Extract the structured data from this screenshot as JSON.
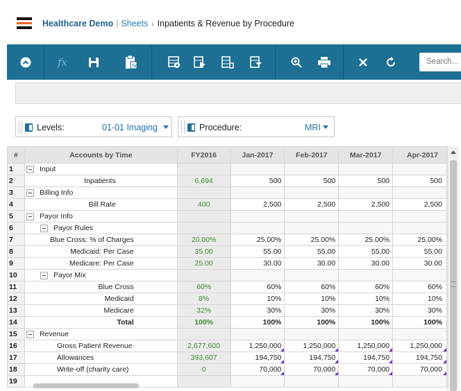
{
  "header": {
    "app_name": "Healthcare Demo",
    "separator": "|",
    "sheets_link": "Sheets",
    "arrow": "›",
    "page_title": "Inpatients & Revenue by Procedure"
  },
  "toolbar": {
    "fx_label": "fx",
    "search_placeholder": "Search...",
    "icons": [
      "collapse-icon",
      "fx-icon",
      "save-icon",
      "clipboard-icon",
      "settings-grid-icon",
      "forward-grid-icon",
      "pivot-icon",
      "filter-grid-icon",
      "zoom-icon",
      "print-icon",
      "close-icon",
      "refresh-icon"
    ]
  },
  "dimensions": [
    {
      "label": "Levels:",
      "value": "01-01 Imaging"
    },
    {
      "label": "Procedure:",
      "value": "MRI"
    }
  ],
  "grid": {
    "headers": [
      "#",
      "Accounts by Time",
      "FY2016",
      "Jan-2017",
      "Feb-2017",
      "Mar-2017",
      "Apr-2017"
    ],
    "rows": [
      {
        "n": "1",
        "label": "Input",
        "toggle": true,
        "indent": 0,
        "fy": "",
        "vals": [
          "",
          "",
          "",
          ""
        ]
      },
      {
        "n": "2",
        "label": "Inpatients",
        "toggle": false,
        "indent": 2,
        "fy": "6,694",
        "vals": [
          "500",
          "500",
          "500",
          "500"
        ]
      },
      {
        "n": "3",
        "label": "Billing Info",
        "toggle": true,
        "indent": 0,
        "fy": "",
        "vals": [
          "",
          "",
          "",
          ""
        ]
      },
      {
        "n": "4",
        "label": "Bill Rate",
        "toggle": false,
        "indent": 2,
        "fy": "400",
        "vals": [
          "2,500",
          "2,500",
          "2,500",
          "2,500"
        ]
      },
      {
        "n": "5",
        "label": "Payor Info",
        "toggle": true,
        "indent": 0,
        "fy": "",
        "vals": [
          "",
          "",
          "",
          ""
        ]
      },
      {
        "n": "6",
        "label": "Payor Rules",
        "toggle": true,
        "indent": 1,
        "fy": "",
        "vals": [
          "",
          "",
          "",
          ""
        ]
      },
      {
        "n": "7",
        "label": "Blue Cross: % of Charges",
        "toggle": false,
        "indent": 3,
        "fy": "20.00%",
        "vals": [
          "25.00%",
          "25.00%",
          "25.00%",
          "25.00%"
        ]
      },
      {
        "n": "8",
        "label": "Medicaid: Per Case",
        "toggle": false,
        "indent": 3,
        "fy": "35.00",
        "vals": [
          "55.00",
          "55.00",
          "55.00",
          "55.00"
        ]
      },
      {
        "n": "9",
        "label": "Medicare: Per Case",
        "toggle": false,
        "indent": 3,
        "fy": "25.00",
        "vals": [
          "30.00",
          "30.00",
          "30.00",
          "30.00"
        ]
      },
      {
        "n": "10",
        "label": "Payor Mix",
        "toggle": true,
        "indent": 1,
        "fy": "",
        "vals": [
          "",
          "",
          "",
          ""
        ]
      },
      {
        "n": "11",
        "label": "Blue Cross",
        "toggle": false,
        "indent": 3,
        "fy": "60%",
        "vals": [
          "60%",
          "60%",
          "60%",
          "60%"
        ]
      },
      {
        "n": "12",
        "label": "Medicaid",
        "toggle": false,
        "indent": 3,
        "fy": "8%",
        "vals": [
          "10%",
          "10%",
          "10%",
          "10%"
        ]
      },
      {
        "n": "13",
        "label": "Medicare",
        "toggle": false,
        "indent": 3,
        "fy": "32%",
        "vals": [
          "30%",
          "30%",
          "30%",
          "30%"
        ]
      },
      {
        "n": "14",
        "label": "Total",
        "toggle": false,
        "indent": 3,
        "bold": true,
        "fy": "100%",
        "vals": [
          "100%",
          "100%",
          "100%",
          "100%"
        ]
      },
      {
        "n": "15",
        "label": "Revenue",
        "toggle": true,
        "indent": 0,
        "fy": "",
        "vals": [
          "",
          "",
          "",
          ""
        ]
      },
      {
        "n": "16",
        "label": "Gross Patient Revenue",
        "toggle": false,
        "indent": 2,
        "fy": "2,677,600",
        "vals": [
          "1,250,000",
          "1,250,000",
          "1,250,000",
          "1,250,000"
        ],
        "tri": true
      },
      {
        "n": "17",
        "label": "Allowances",
        "toggle": false,
        "indent": 2,
        "fy": "393,607",
        "vals": [
          "194,750",
          "194,750",
          "194,750",
          "194,750"
        ],
        "tri": true
      },
      {
        "n": "18",
        "label": "Write-off (charity care)",
        "toggle": false,
        "indent": 2,
        "fy": "0",
        "vals": [
          "70,000",
          "70,000",
          "70,000",
          "70,000"
        ],
        "tri": true
      },
      {
        "n": "19",
        "label": "",
        "toggle": false,
        "indent": 0,
        "fy": "",
        "vals": [
          "",
          "",
          "",
          ""
        ]
      }
    ]
  },
  "colors": {
    "toolbar": "#1d6f93",
    "fy_value": "#3d8b2e",
    "link": "#2a7ab8",
    "accent": "#f26522",
    "comment_marker": "#6a2ec0"
  }
}
